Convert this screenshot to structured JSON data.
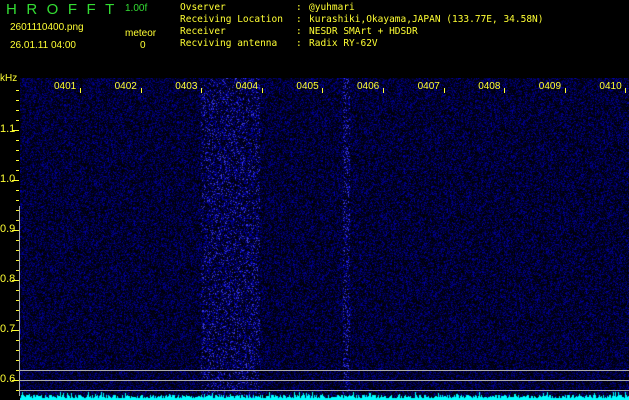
{
  "header": {
    "app_title": "HROFFT",
    "version": "1.00f",
    "filename": "2601110400.png",
    "datetime": "26.01.11 04:00",
    "meteor_label": "meteor",
    "meteor_count": "0"
  },
  "info": [
    {
      "label": "Ovserver",
      "value": "@yuhmari"
    },
    {
      "label": "Receiving Location",
      "value": "kurashiki,Okayama,JAPAN (133.77E, 34.58N)"
    },
    {
      "label": "Receiver",
      "value": "NESDR SMArt + HDSDR"
    },
    {
      "label": "Recviving antenna",
      "value": "Radix RY-62V"
    }
  ],
  "axis": {
    "y_unit": "kHz",
    "y_labels": [
      "1.1",
      "1.0",
      "0.9",
      "0.8",
      "0.7",
      "0.6"
    ],
    "time_labels": [
      "0401",
      "0402",
      "0403",
      "0404",
      "0405",
      "0406",
      "0407",
      "0408",
      "0409",
      "0410"
    ]
  },
  "colors": {
    "text": "#ffff33",
    "title": "#33dd33",
    "signal": "#2020ff",
    "spectrum": "#00ffff"
  }
}
